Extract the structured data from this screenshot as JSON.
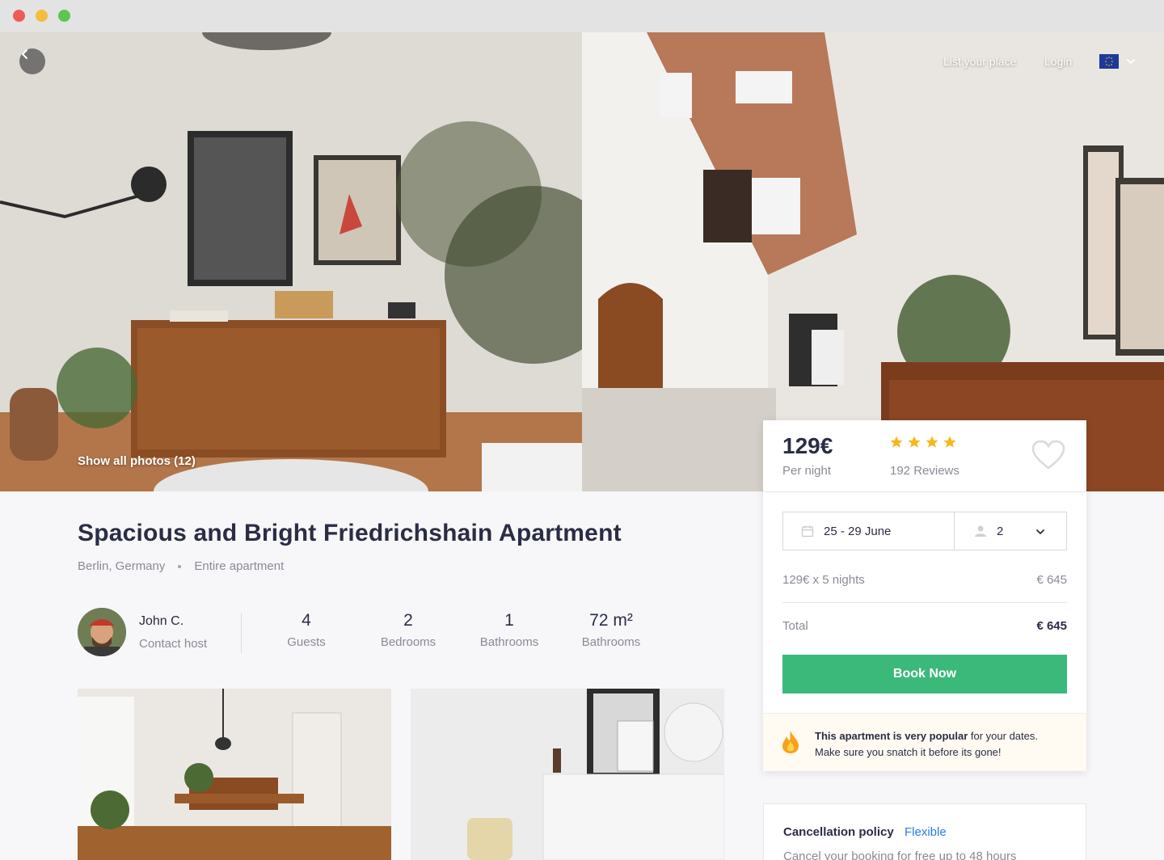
{
  "nav": {
    "list_place": "List your place",
    "login": "Login",
    "language_flag": "eu-flag-icon"
  },
  "hero": {
    "show_photos": "Show all photos (12)"
  },
  "listing": {
    "title": "Spacious and Bright Friedrichshain Apartment",
    "location": "Berlin, Germany",
    "type": "Entire apartment"
  },
  "host": {
    "name": "John C.",
    "contact": "Contact host"
  },
  "stats": [
    {
      "value": "4",
      "label": "Guests"
    },
    {
      "value": "2",
      "label": "Bedrooms"
    },
    {
      "value": "1",
      "label": "Bathrooms"
    },
    {
      "value": "72 m²",
      "label": "Bathrooms"
    }
  ],
  "booking": {
    "price": "129€",
    "per_night": "Per night",
    "rating_stars": 4,
    "reviews": "192 Reviews",
    "dates": "25 - 29 June",
    "guests": "2",
    "nights_label": "129€ x 5 nights",
    "nights_value": "€ 645",
    "total_label": "Total",
    "total_value": "€ 645",
    "book_now": "Book Now",
    "popular_bold": "This apartment is very popular",
    "popular_rest": " for your dates.",
    "popular_line2": "Make sure you snatch it before its gone!"
  },
  "cancellation": {
    "title": "Cancellation policy",
    "policy": "Flexible",
    "description": "Cancel your booking for free up to 48 hours"
  },
  "colors": {
    "accent_green": "#3bb97a",
    "star_yellow": "#f6b71b",
    "link_blue": "#2c7be5",
    "title_navy": "#2a2d45"
  }
}
